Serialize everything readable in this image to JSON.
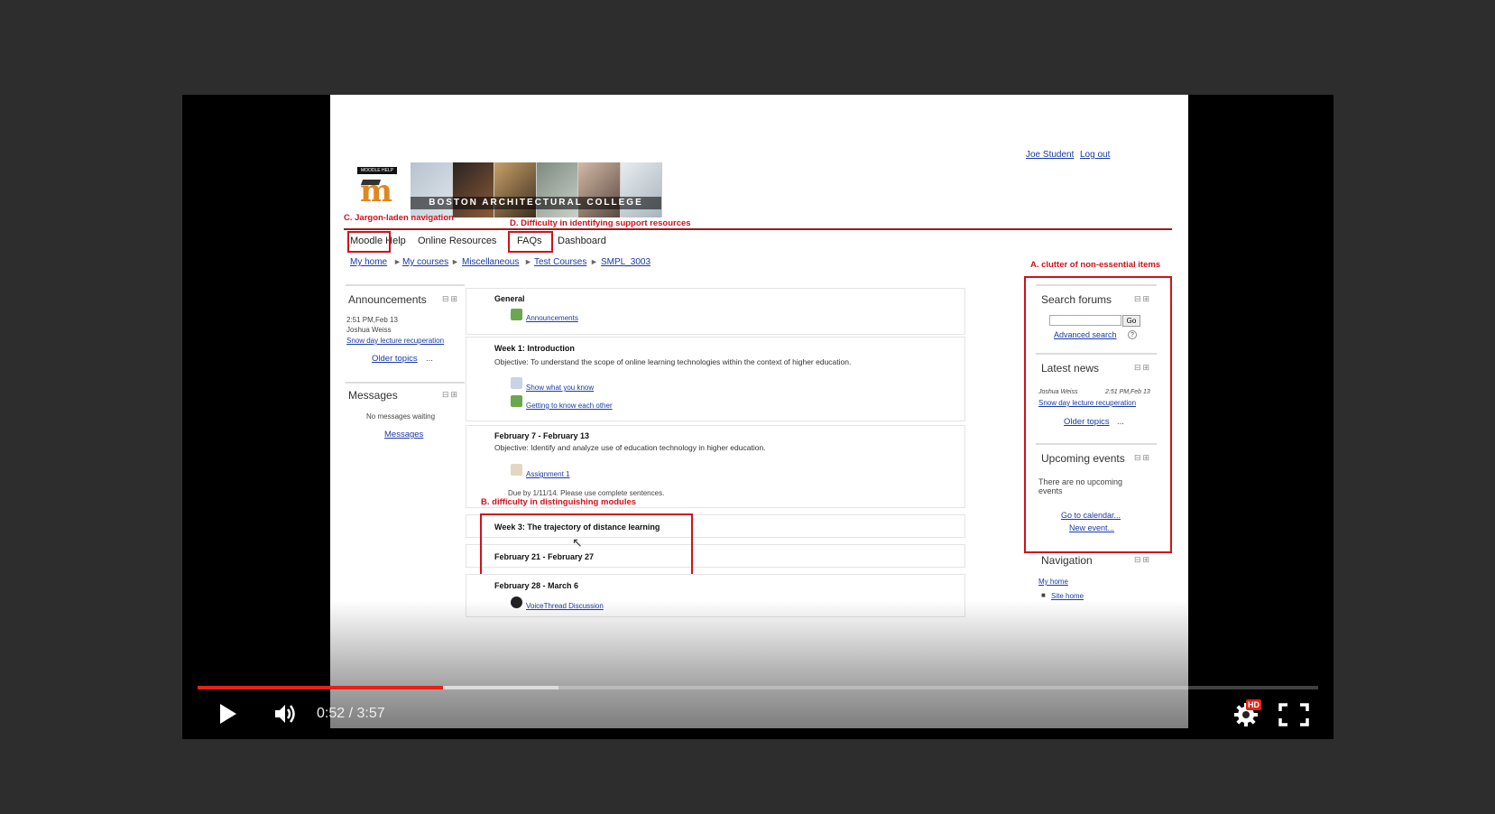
{
  "player": {
    "time_current": "0:52",
    "time_separator": "/",
    "time_total": "3:57",
    "progress_fraction": 0.219,
    "hd_badge": "HD",
    "icons": [
      "play-icon",
      "volume-icon",
      "settings-icon",
      "fullscreen-icon"
    ],
    "accent_color": "#e62117"
  },
  "moodle": {
    "user_name": "Joe Student",
    "logout": "Log out",
    "logo_tag": "MOODLE HELP",
    "banner_text": "BOSTON ARCHITECTURAL COLLEGE",
    "nav": [
      "Moodle Help",
      "Online Resources",
      "FAQs",
      "Dashboard"
    ],
    "breadcrumb": [
      "My home",
      "My courses",
      "Miscellaneous",
      "Test Courses",
      "SMPL_3003"
    ],
    "breadcrumb_sep": "►",
    "left_blocks": {
      "announcements": {
        "title": "Announcements",
        "time": "2:51 PM,Feb 13",
        "author": "Joshua Weiss",
        "post": "Snow day lecture recuperation",
        "older": "Older topics",
        "ellipsis": "..."
      },
      "messages": {
        "title": "Messages",
        "status": "No messages waiting",
        "link": "Messages"
      }
    },
    "sections": [
      {
        "title": "General",
        "activities": [
          "Announcements"
        ]
      },
      {
        "title": "Week 1: Introduction",
        "objective": "Objective: To understand the scope of online learning technologies within the context of higher education.",
        "activities": [
          "Show what you know",
          "Getting to know each other"
        ]
      },
      {
        "title": "February 7 - February 13",
        "objective": "Objective: Identify and analyze use of education technology in higher education.",
        "activities": [
          "Assignment 1"
        ],
        "note": "Due by 1/11/14. Please use complete sentences."
      },
      {
        "title": "Week 3: The trajectory of distance learning"
      },
      {
        "title": "February 21 - February 27"
      },
      {
        "title": "February 28 - March 6",
        "activities": [
          "VoiceThread Discussion"
        ]
      }
    ],
    "right_blocks": {
      "search": {
        "title": "Search forums",
        "button": "Go",
        "advanced": "Advanced search",
        "help": "?"
      },
      "news": {
        "title": "Latest news",
        "author": "Joshua Weiss",
        "time": "2:51 PM,Feb 13",
        "post": "Snow day lecture recuperation",
        "older": "Older topics",
        "ellipsis": "..."
      },
      "events": {
        "title": "Upcoming events",
        "status": "There are no upcoming events",
        "calendar": "Go to calendar...",
        "new": "New event..."
      },
      "navigation": {
        "title": "Navigation",
        "myhome": "My home",
        "sitehome": "Site home"
      }
    },
    "block_controls": "⊟⊞"
  },
  "annotations": {
    "a": "A. clutter of non-essential items",
    "b": "B. difficulty in distinguishing modules",
    "c": "C. Jargon-laden navigation",
    "d": "D. Difficulty in identifying support resources",
    "color": "#d0121b"
  }
}
